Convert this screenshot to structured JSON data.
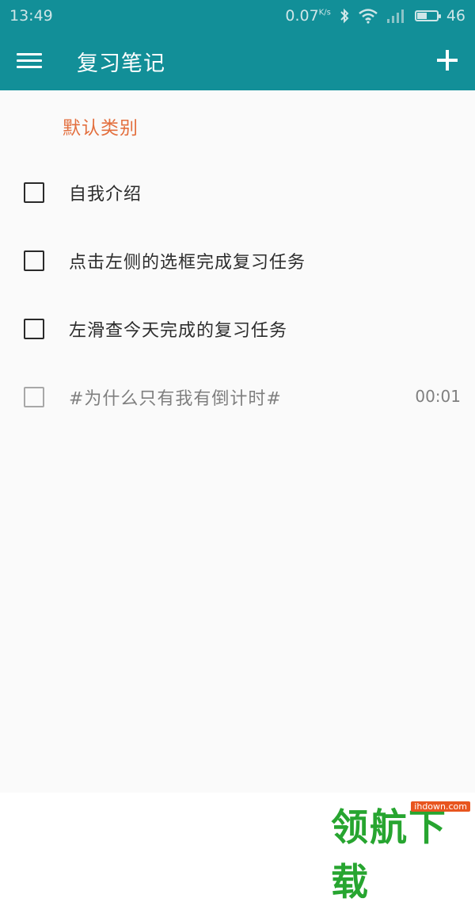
{
  "status_bar": {
    "time": "13:49",
    "speed": "0.07",
    "speed_unit": "K/s",
    "signal": "46",
    "icons": [
      "bluetooth-icon",
      "wifi-icon",
      "signal-icon",
      "battery-icon"
    ]
  },
  "app_bar": {
    "title": "复习笔记",
    "menu_icon": "menu-icon",
    "add_icon": "plus-icon",
    "background_color": "#128f98"
  },
  "category": {
    "label": "默认类别",
    "color": "#e36f3e"
  },
  "tasks": [
    {
      "text": "自我介绍",
      "checked": false
    },
    {
      "text": "点击左侧的选框完成复习任务",
      "checked": false
    },
    {
      "text": "左滑查今天完成的复习任务",
      "checked": false
    },
    {
      "text": "#为什么只有我有倒计时#",
      "checked": false,
      "timer": "00:01"
    }
  ],
  "watermark": {
    "text": "领航下载",
    "url": "ihdown.com"
  }
}
